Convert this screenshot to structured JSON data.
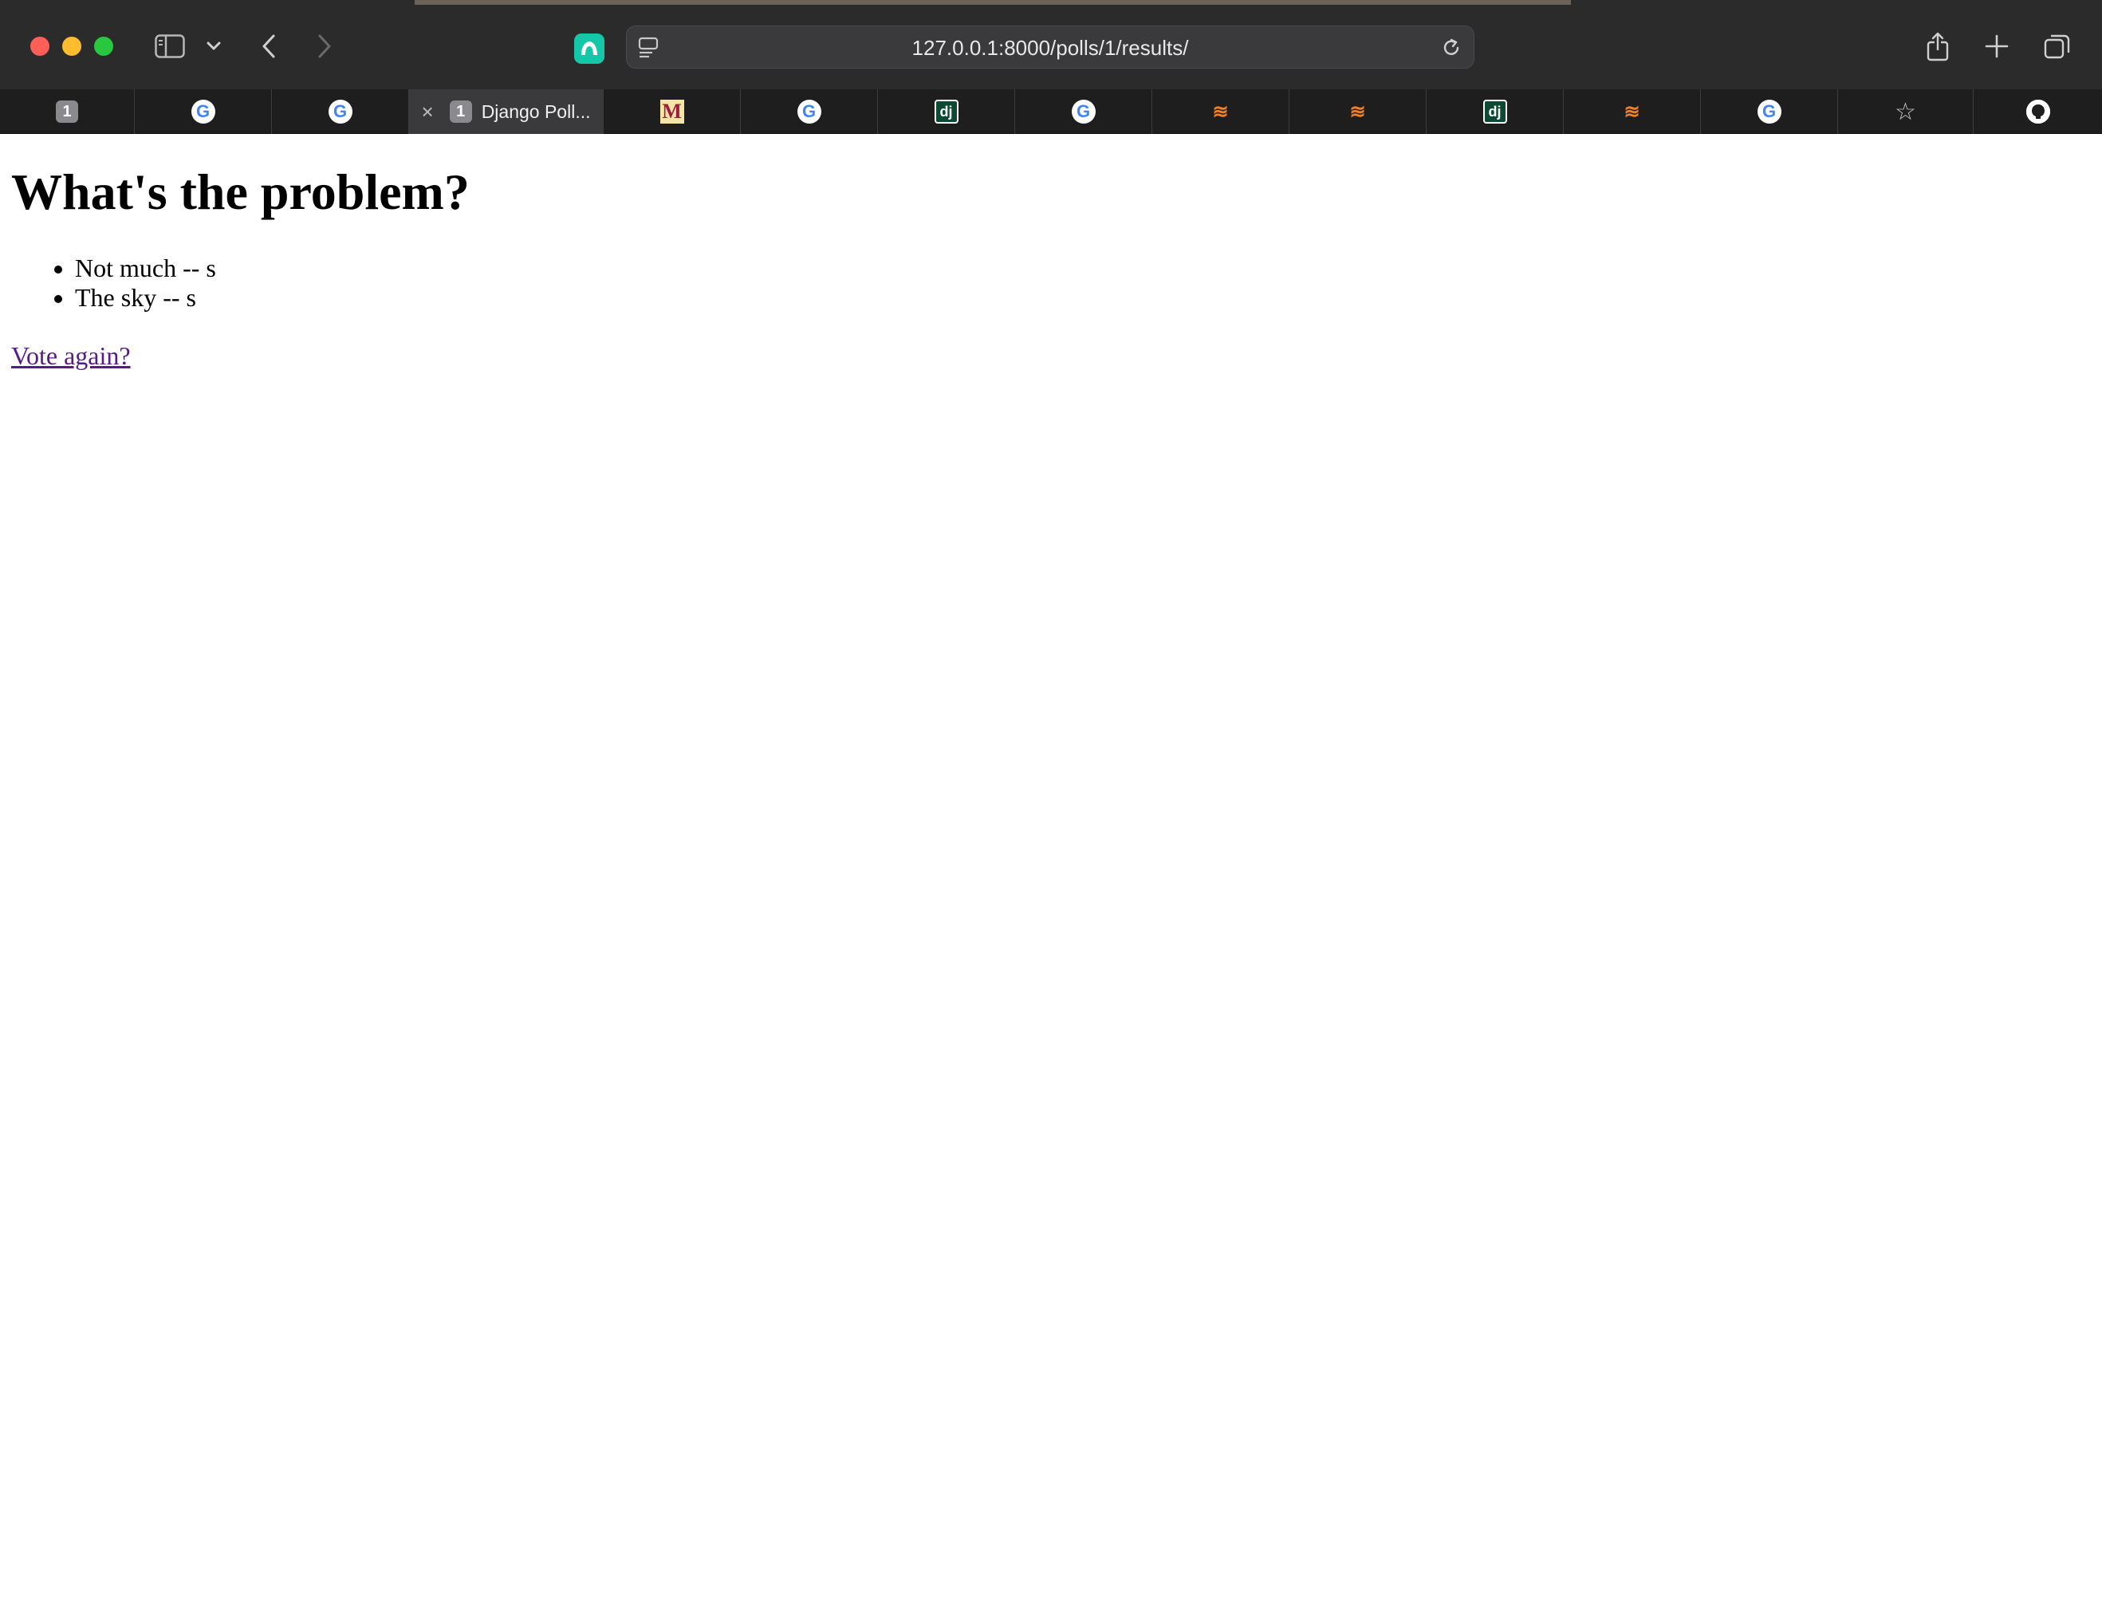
{
  "browser": {
    "url": "127.0.0.1:8000/polls/1/results/",
    "traffic_lights": {
      "close": "#ff5f57",
      "minimize": "#febc2e",
      "zoom": "#28c840"
    },
    "toolbar_icons": [
      "sidebar-icon",
      "chevron-down-icon",
      "back-icon",
      "forward-icon",
      "extension-icon",
      "page-menu-icon",
      "reload-icon",
      "share-icon",
      "new-tab-icon",
      "tab-overview-icon"
    ]
  },
  "tabs": [
    {
      "favicon": "badge",
      "badge_text": "1"
    },
    {
      "favicon": "google",
      "glyph": "G"
    },
    {
      "favicon": "google",
      "glyph": "G"
    },
    {
      "favicon": "badge",
      "badge_text": "1",
      "title": "Django Poll...",
      "active": true,
      "close_glyph": "×"
    },
    {
      "favicon": "m-logo",
      "glyph": "M"
    },
    {
      "favicon": "google",
      "glyph": "G"
    },
    {
      "favicon": "django",
      "glyph": "dj"
    },
    {
      "favicon": "google",
      "glyph": "G"
    },
    {
      "favicon": "stackoverflow",
      "glyph": "≋"
    },
    {
      "favicon": "stackoverflow",
      "glyph": "≋"
    },
    {
      "favicon": "django",
      "glyph": "dj"
    },
    {
      "favicon": "stackoverflow",
      "glyph": "≋"
    },
    {
      "favicon": "google",
      "glyph": "G"
    },
    {
      "favicon": "star",
      "glyph": "☆"
    },
    {
      "favicon": "github"
    }
  ],
  "page": {
    "question": "What's the problem?",
    "choices": [
      "Not much -- s",
      "The sky -- s"
    ],
    "vote_again_label": "Vote again?",
    "link_color": "#551a8b"
  }
}
